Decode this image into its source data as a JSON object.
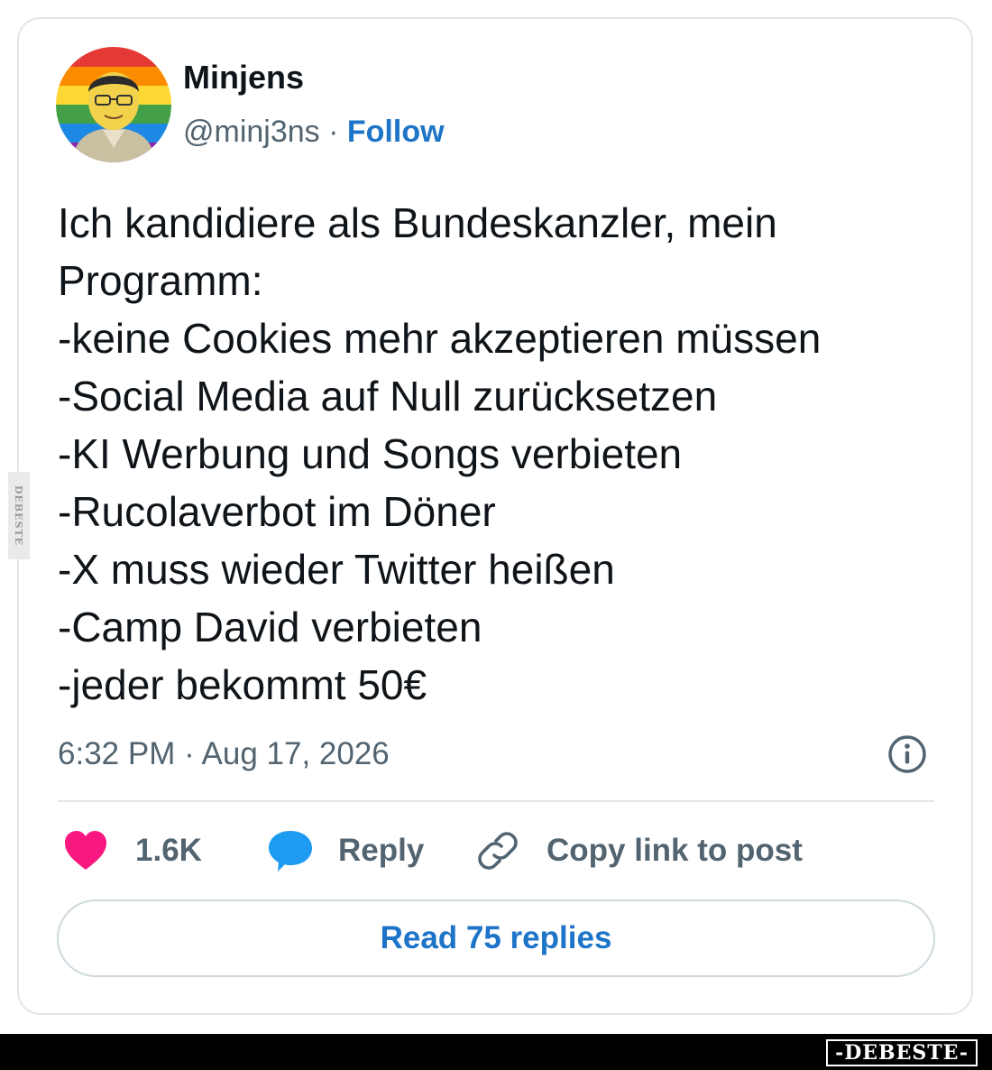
{
  "tweet": {
    "author_name": "Minjens",
    "handle": "@minj3ns",
    "separator": " · ",
    "follow_label": "Follow",
    "text_lines": [
      "Ich kandidiere als Bundeskanzler, mein",
      "Programm:",
      "-keine Cookies mehr akzeptieren müssen",
      "-Social Media auf Null zurücksetzen",
      "-KI Werbung und Songs verbieten",
      "-Rucolaverbot im Döner",
      "-X muss wieder Twitter heißen",
      "-Camp David verbieten",
      "-jeder bekommt 50€"
    ],
    "timestamp": "6:32 PM · Aug 17, 2026"
  },
  "actions": {
    "like_count": "1.6K",
    "reply_label": "Reply",
    "copy_link_label": "Copy link to post"
  },
  "read_replies_label": "Read 75 replies",
  "watermark": {
    "side": "DEBESTE",
    "bottom": "-DEBESTE-"
  },
  "icons": {
    "like": "heart-icon",
    "reply": "speech-bubble-icon",
    "copy": "link-icon",
    "info": "info-icon"
  },
  "colors": {
    "link_blue": "#1d74c8",
    "heart_pink": "#f91880",
    "reply_blue": "#1d9bf0",
    "muted_text": "#536471"
  }
}
